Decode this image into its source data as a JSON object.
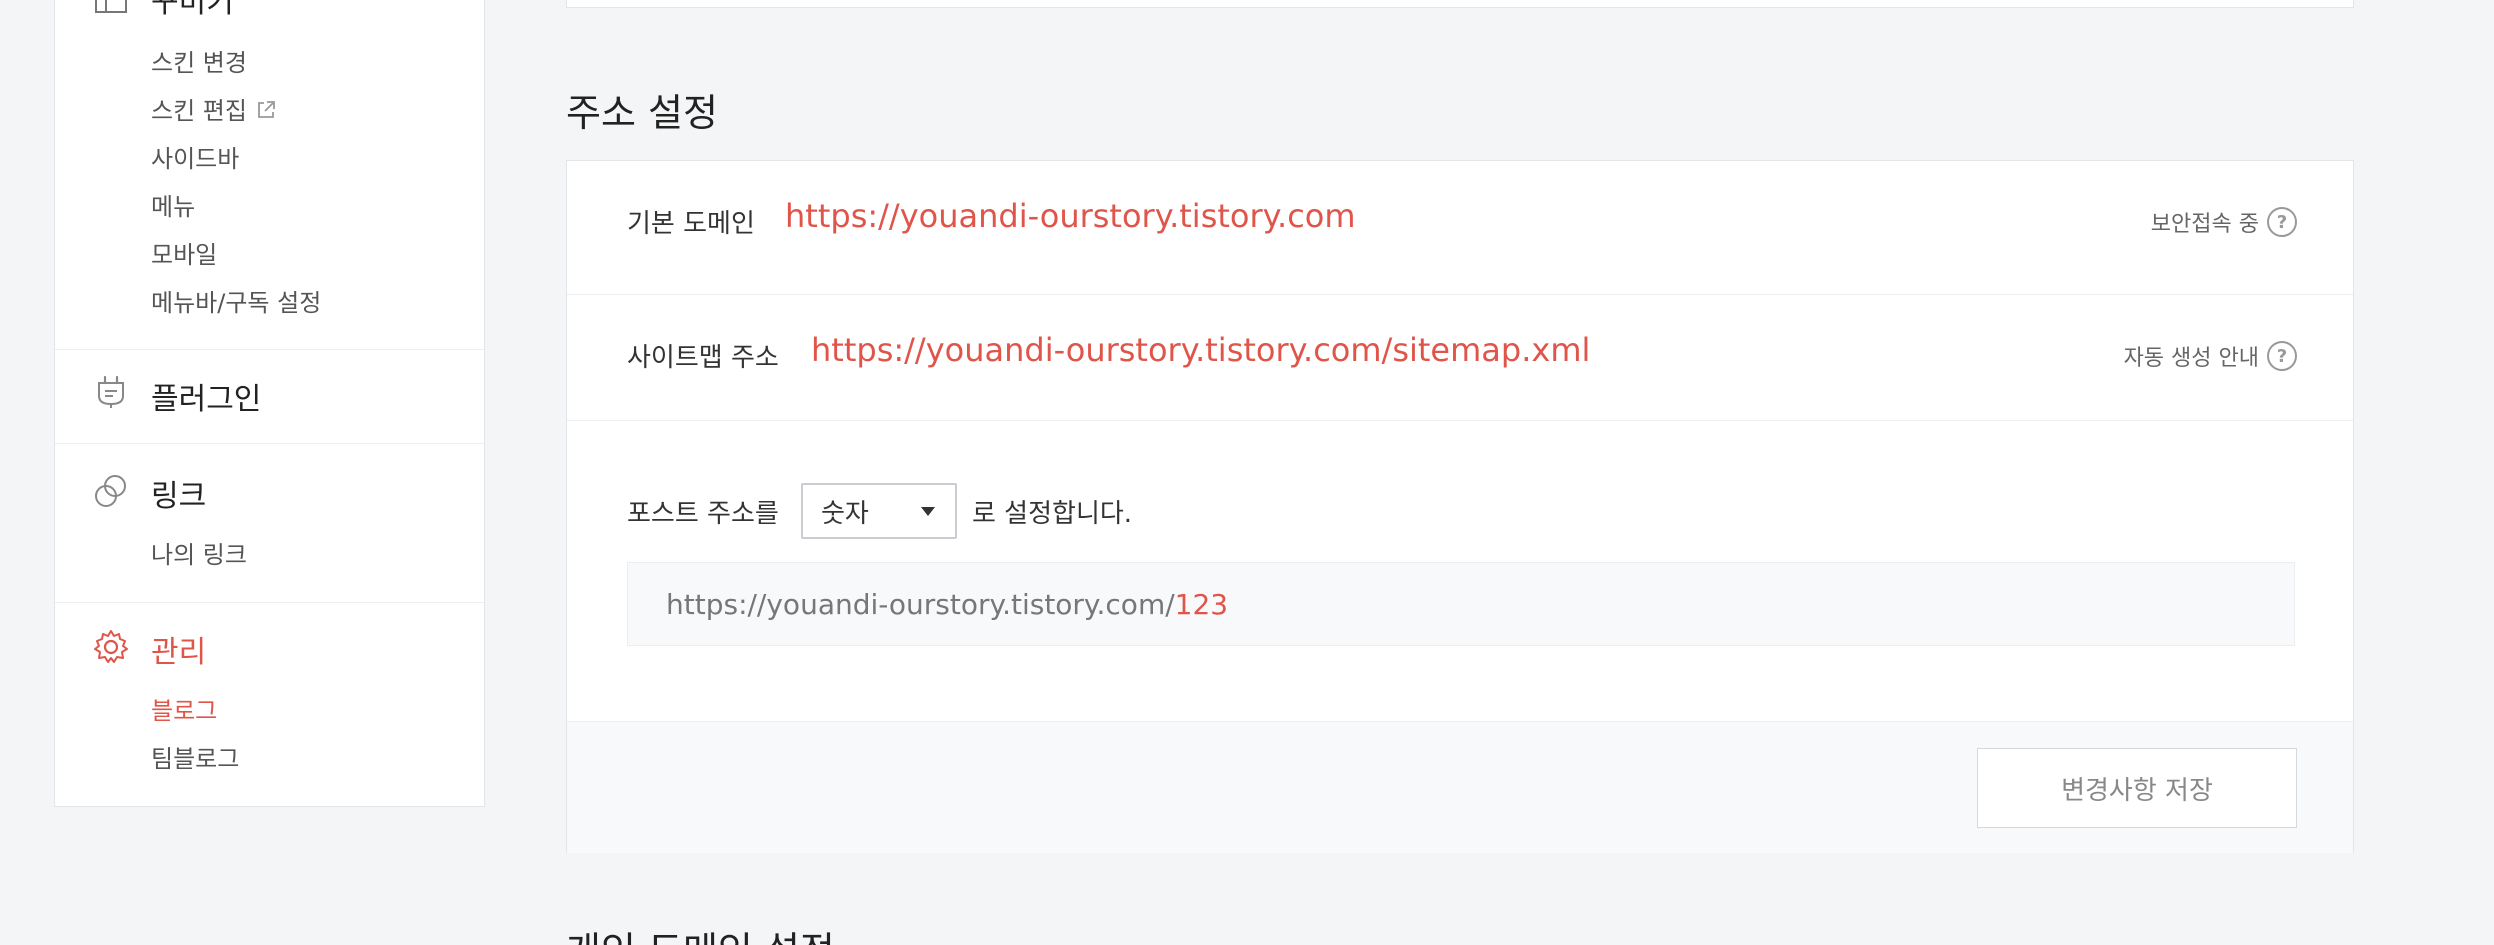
{
  "sidebar": {
    "decorate": {
      "title": "꾸미기",
      "items": [
        "스킨 변경",
        "스킨 편집",
        "사이드바",
        "메뉴",
        "모바일",
        "메뉴바/구독 설정"
      ]
    },
    "plugin": {
      "title": "플러그인"
    },
    "link": {
      "title": "링크",
      "items": [
        "나의 링크"
      ]
    },
    "manage": {
      "title": "관리",
      "items": [
        "블로그",
        "팀블로그"
      ]
    }
  },
  "address": {
    "title": "주소 설정",
    "default_domain": {
      "label": "기본 도메인",
      "url": "https://youandi-ourstory.tistory.com",
      "help": "보안접속 중"
    },
    "sitemap": {
      "label": "사이트맵 주소",
      "url": "https://youandi-ourstory.tistory.com/sitemap.xml",
      "help": "자동 생성 안내"
    },
    "post": {
      "label_before": "포스트 주소를",
      "select_value": "숫자",
      "label_after": "로 설정합니다.",
      "preview_base": "https://youandi-ourstory.tistory.com/",
      "preview_suffix": "123"
    },
    "save_label": "변경사항 저장"
  },
  "next_section_title": "개인 도메인 설정",
  "colors": {
    "accent": "#e0554a",
    "background": "#f4f5f7"
  }
}
